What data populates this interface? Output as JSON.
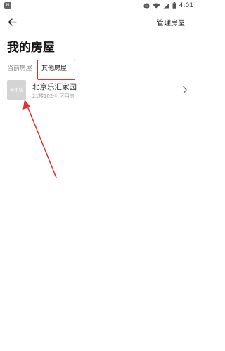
{
  "status_bar": {
    "notification_icon_text": "N",
    "time": "4:01"
  },
  "header": {
    "manage_label": "管理房屋",
    "title": "我的房屋"
  },
  "tabs": [
    {
      "label": "当前房屋",
      "active": false
    },
    {
      "label": "其他房屋",
      "active": true
    }
  ],
  "houses": [
    {
      "thumb_label": "待审核",
      "name": "北京乐汇家园",
      "detail": "21楼102-社区用房"
    }
  ],
  "colors": {
    "highlight": "#e03030",
    "thumb_bg": "#d4d4d4"
  }
}
